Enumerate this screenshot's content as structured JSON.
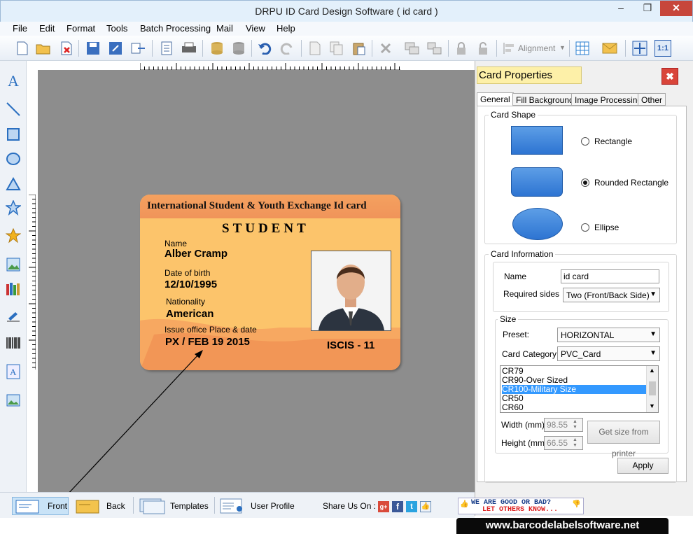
{
  "window": {
    "title": "DRPU ID Card Design Software ( id card )"
  },
  "menu": [
    "File",
    "Edit",
    "Format",
    "Tools",
    "Batch Processing",
    "Mail",
    "View",
    "Help"
  ],
  "toolbar": {
    "alignment_label": "Alignment"
  },
  "card": {
    "header": "International Student & Youth Exchange Id card",
    "role": "STUDENT",
    "name_label": "Name",
    "name_value": "Alber Cramp",
    "dob_label": "Date of birth",
    "dob_value": "12/10/1995",
    "nationality_label": "Nationality",
    "nationality_value": "American",
    "issue_label": "Issue office Place & date",
    "issue_value": "PX / FEB 19 2015",
    "code": "ISCIS - 11"
  },
  "panel": {
    "title": "Card Properties",
    "tabs": [
      "General",
      "Fill Background",
      "Image Processing",
      "Other"
    ],
    "card_shape_label": "Card Shape",
    "shapes": [
      "Rectangle",
      "Rounded Rectangle",
      "Ellipse"
    ],
    "selected_shape": "Rounded Rectangle",
    "card_info_label": "Card Information",
    "name_label": "Name",
    "name_value": "id card",
    "required_sides_label": "Required sides",
    "required_sides_value": "Two (Front/Back Side)",
    "size_label": "Size",
    "preset_label": "Preset:",
    "preset_value": "HORIZONTAL",
    "category_label": "Card Category",
    "category_value": "PVC_Card",
    "size_list": [
      "CR79",
      "CR90-Over Sized",
      "CR100-Military Size",
      "CR50",
      "CR60"
    ],
    "selected_size": "CR100-Military Size",
    "width_label": "Width  (mm)",
    "width_value": "98.55",
    "height_label": "Height  (mm)",
    "height_value": "66.55",
    "get_size_button": "Get size from printer",
    "apply_button": "Apply"
  },
  "bottom": {
    "front": "Front",
    "back": "Back",
    "templates": "Templates",
    "user_profile": "User Profile",
    "share": "Share Us On :",
    "feedback_line1": "WE ARE GOOD OR BAD?",
    "feedback_line2": "LET OTHERS KNOW..."
  },
  "website": "www.barcodelabelsoftware.net",
  "colors": {
    "card_bg": "#fcc46b",
    "card_header": "#f0945a",
    "canvas": "#8d8d8d",
    "selection": "#3399ff"
  }
}
